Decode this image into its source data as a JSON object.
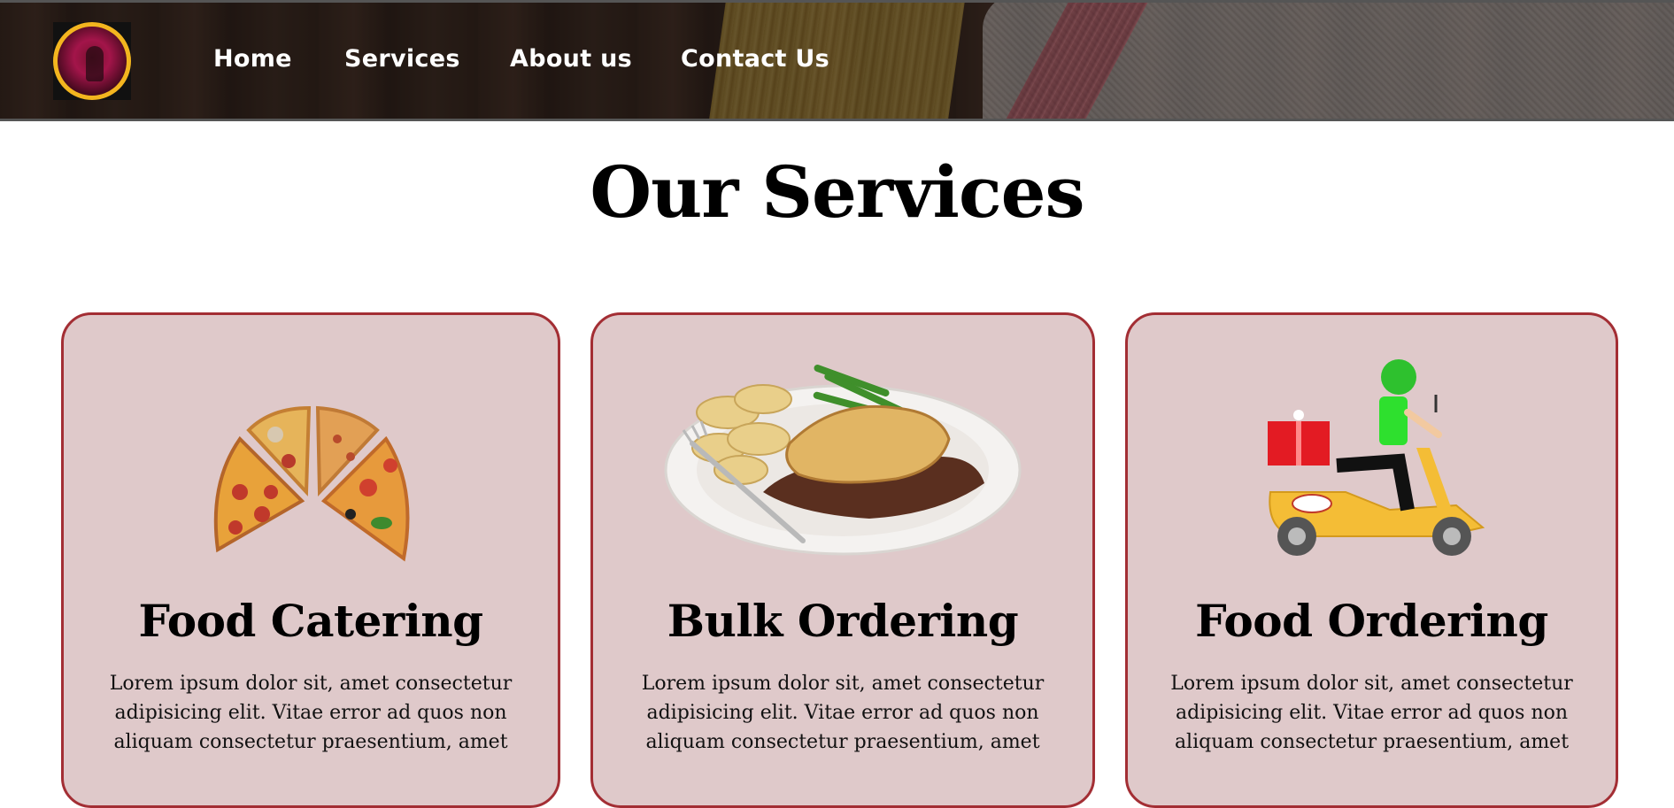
{
  "header": {
    "nav": [
      {
        "label": "Home"
      },
      {
        "label": "Services"
      },
      {
        "label": "About us"
      },
      {
        "label": "Contact Us"
      }
    ]
  },
  "main": {
    "title": "Our Services",
    "cards": [
      {
        "title": "Food Catering",
        "text": "Lorem ipsum dolor sit, amet consectetur adipisicing elit. Vitae error ad quos non aliquam consectetur praesentium, amet",
        "image": "pizza-slices-image"
      },
      {
        "title": "Bulk Ordering",
        "text": "Lorem ipsum dolor sit, amet consectetur adipisicing elit. Vitae error ad quos non aliquam consectetur praesentium, amet",
        "image": "pie-plate-image"
      },
      {
        "title": "Food Ordering",
        "text": "Lorem ipsum dolor sit, amet consectetur adipisicing elit. Vitae error ad quos non aliquam consectetur praesentium, amet",
        "image": "delivery-scooter-image"
      }
    ]
  },
  "colors": {
    "card_bg": "#dfc9ca",
    "card_border": "#a32e34",
    "logo_ring": "#f3b51f"
  }
}
